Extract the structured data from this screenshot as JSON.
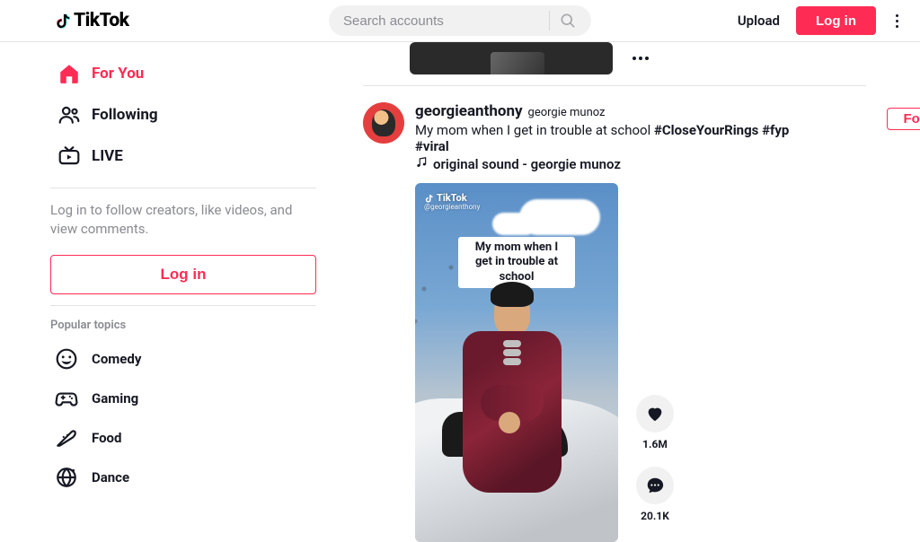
{
  "header": {
    "logo": "TikTok",
    "search_placeholder": "Search accounts",
    "upload": "Upload",
    "login": "Log in"
  },
  "sidebar": {
    "nav": {
      "for_you": "For You",
      "following": "Following",
      "live": "LIVE"
    },
    "login_hint": "Log in to follow creators, like videos, and view comments.",
    "login_button": "Log in",
    "topics_heading": "Popular topics",
    "topics": {
      "comedy": "Comedy",
      "gaming": "Gaming",
      "food": "Food",
      "dance": "Dance"
    }
  },
  "post": {
    "username": "georgieanthony",
    "display_name": "georgie munoz",
    "caption_text": "My mom when I get in trouble at school ",
    "tags": "#CloseYourRings #fyp #viral",
    "sound": "original sound - georgie munoz",
    "follow": "Follow",
    "video_overlay": "My mom when I get in trouble at school",
    "watermark": "TikTok",
    "watermark_user": "@georgieanthony",
    "likes": "1.6M",
    "comments": "20.1K"
  }
}
